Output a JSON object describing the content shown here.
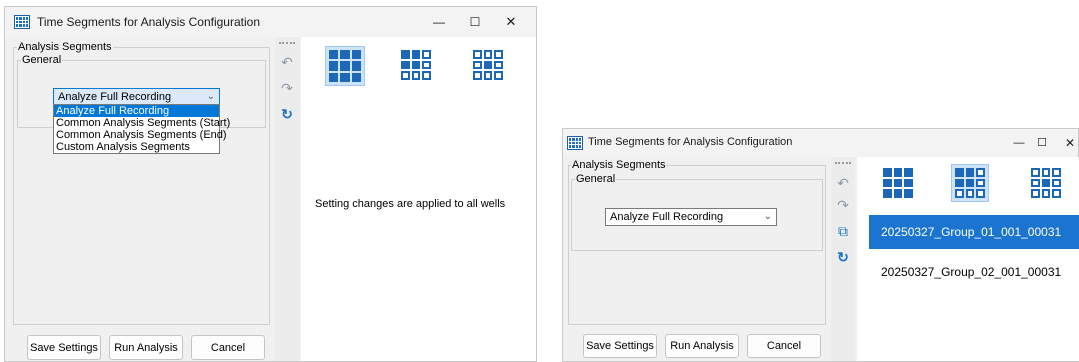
{
  "window_left": {
    "title": "Time Segments for Analysis Configuration",
    "controls": {
      "minimize": "—",
      "maximize": "☐",
      "close": "✕"
    },
    "group_label": "Analysis Segments",
    "subgroup_label": "General",
    "combo_value": "Analyze Full Recording",
    "dropdown_options": [
      "Analyze Full Recording",
      "Common Analysis Segments (Start)",
      "Common Analysis Segments (End)",
      "Custom Analysis Segments"
    ],
    "selected_option_index": 0,
    "message": "Setting changes are applied to all wells",
    "selected_layout": "layout-3x3-filled",
    "buttons": {
      "save": "Save Settings",
      "run": "Run Analysis",
      "cancel": "Cancel"
    }
  },
  "window_right": {
    "title": "Time Segments for Analysis Configuration",
    "controls": {
      "minimize": "—",
      "maximize": "☐",
      "close": "✕"
    },
    "group_label": "Analysis Segments",
    "subgroup_label": "General",
    "combo_value": "Analyze Full Recording",
    "selected_layout": "layout-mixed",
    "items": [
      "20250327_Group_01_001_00031",
      "20250327_Group_02_001_00031"
    ],
    "selected_item_index": 0,
    "buttons": {
      "save": "Save Settings",
      "run": "Run Analysis",
      "cancel": "Cancel"
    }
  },
  "tools": {
    "undo": "undo-icon",
    "redo": "redo-icon",
    "copy": "copy-icon",
    "refresh": "refresh-icon"
  },
  "colors": {
    "accent": "#0078d7",
    "icon_blue": "#1c67b8",
    "selection": "#1b75d0"
  }
}
